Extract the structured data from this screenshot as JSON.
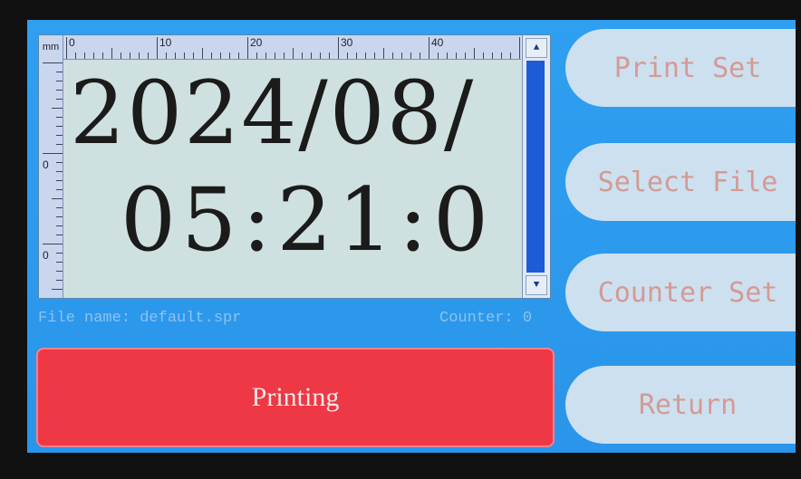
{
  "preview": {
    "ruler_unit": "mm",
    "ruler_top_labels": [
      "0",
      "10",
      "20",
      "30",
      "40"
    ],
    "ruler_left_labels": [
      "0",
      "0"
    ],
    "line1": "2024/08/",
    "line2": "05:21:0"
  },
  "info": {
    "file_name": "File name: default.spr",
    "counter": "Counter: 0"
  },
  "buttons": {
    "printing": "Printing",
    "print_set": "Print Set",
    "select_file": "Select File",
    "counter_set": "Counter Set",
    "return": "Return"
  },
  "colors": {
    "screen_bg": "#2f9ff0",
    "printing_bg": "#ee3845",
    "side_button_bg": "#cde0ef",
    "side_button_text": "#d49a94"
  },
  "icons": [
    "scroll-up-arrow-icon",
    "scroll-down-arrow-icon"
  ]
}
